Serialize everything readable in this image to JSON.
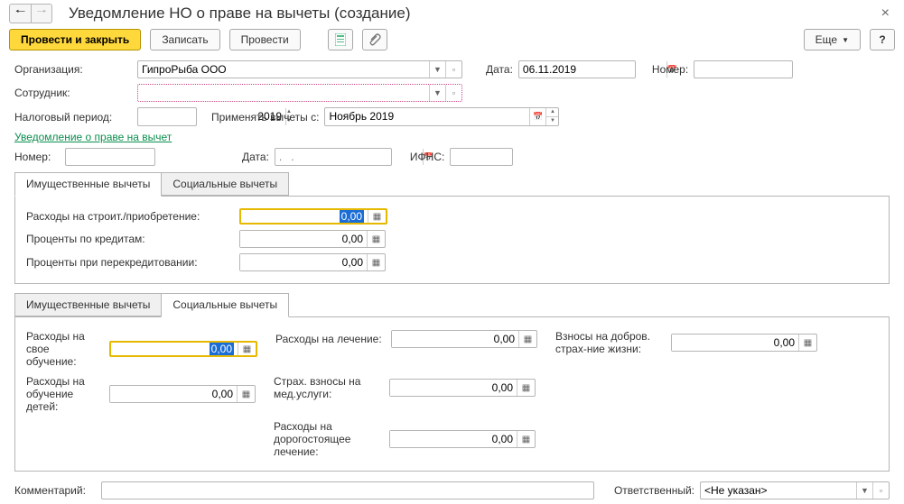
{
  "window": {
    "title": "Уведомление НО о праве на вычеты (создание)"
  },
  "toolbar": {
    "post_close": "Провести и закрыть",
    "write": "Записать",
    "post": "Провести",
    "more": "Еще"
  },
  "form": {
    "org_label": "Организация:",
    "org_value": "ГипроРыба ООО",
    "date_label": "Дата:",
    "date_value": "06.11.2019",
    "number_label": "Номер:",
    "number_value": "",
    "employee_label": "Сотрудник:",
    "employee_value": "",
    "tax_period_label": "Налоговый период:",
    "tax_period_value": "2019",
    "apply_from_label": "Применять вычеты с:",
    "apply_from_value": "Ноябрь 2019",
    "rights_link": "Уведомление о праве на вычет",
    "notice_number_label": "Номер:",
    "notice_number_value": "",
    "notice_date_label": "Дата:",
    "notice_date_placeholder": ".   .",
    "ifns_label": "ИФНС:",
    "ifns_value": ""
  },
  "tabs1": {
    "prop": "Имущественные вычеты",
    "social": "Социальные вычеты",
    "exp_build_label": "Расходы на строит./приобретение:",
    "exp_build_value": "0,00",
    "interest_label": "Проценты по кредитам:",
    "interest_value": "0,00",
    "refinance_label": "Проценты при перекредитовании:",
    "refinance_value": "0,00"
  },
  "tabs2": {
    "prop": "Имущественные вычеты",
    "social": "Социальные вычеты",
    "own_edu_label": "Расходы на свое обучение:",
    "own_edu_value": "0,00",
    "treatment_label": "Расходы на лечение:",
    "treatment_value": "0,00",
    "volins_label": "Взносы на добров. страх-ние жизни:",
    "volins_value": "0,00",
    "child_edu_label": "Расходы на обучение детей:",
    "child_edu_value": "0,00",
    "med_ins_label": "Страх. взносы на мед.услуги:",
    "med_ins_value": "0,00",
    "expensive_treat_label": "Расходы на дорогостоящее лечение:",
    "expensive_treat_value": "0,00"
  },
  "footer": {
    "comment_label": "Комментарий:",
    "comment_value": "",
    "responsible_label": "Ответственный:",
    "responsible_value": "<Не указан>"
  }
}
